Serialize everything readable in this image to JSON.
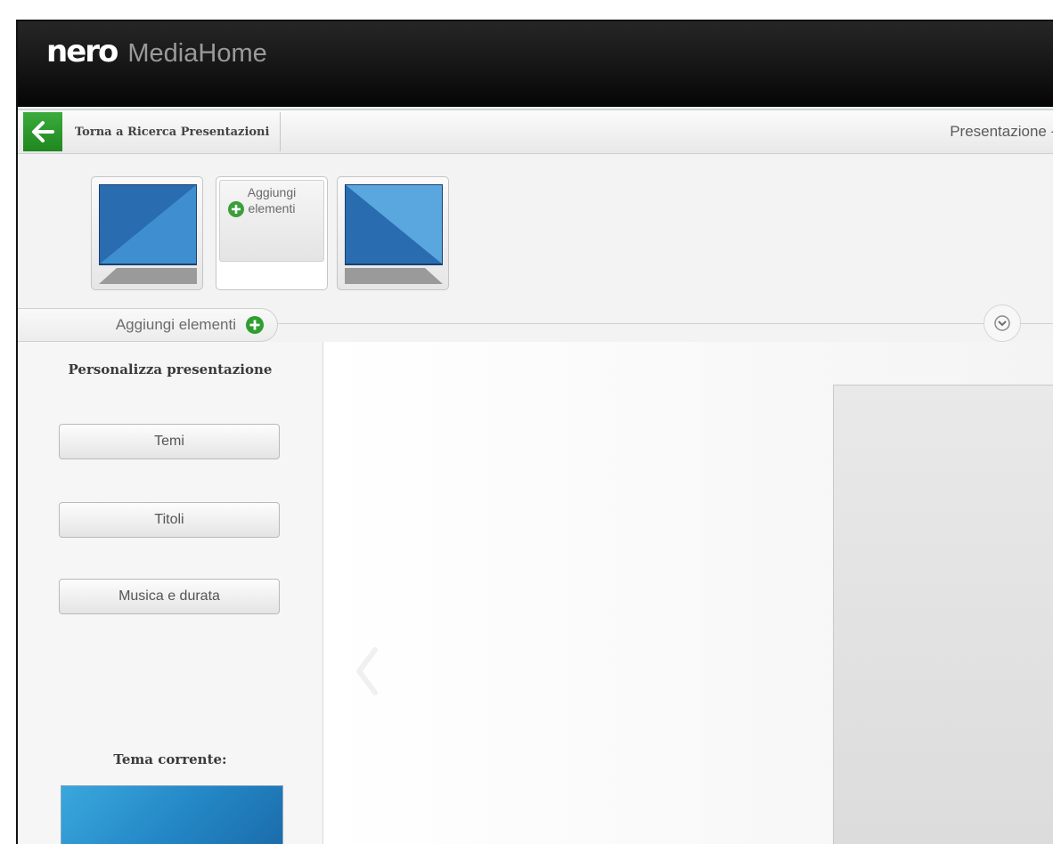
{
  "app": {
    "brand_nero": "nero",
    "brand_product": "MediaHome"
  },
  "nav": {
    "back_label": "Torna a Ricerca Presentazioni",
    "title": "Presentazione - Esta"
  },
  "strip": {
    "add_tile_label": "Aggiungi elementi",
    "add_tab_label": "Aggiungi elementi",
    "thumbnails": [
      {
        "kind": "slide"
      },
      {
        "kind": "add"
      },
      {
        "kind": "slide"
      }
    ]
  },
  "panel": {
    "title": "Personalizza presentazione",
    "buttons": [
      "Temi",
      "Titoli",
      "Musica e durata"
    ],
    "current_theme_label": "Tema corrente:"
  },
  "colors": {
    "accent_green": "#2f9e2f",
    "titlebar": "#111111",
    "slide_blue": "#2f7fc4"
  },
  "icons": {
    "back": "arrow-left-icon",
    "add": "plus-circle-icon",
    "collapse": "chevron-down-icon",
    "prev": "chevron-left-icon"
  }
}
